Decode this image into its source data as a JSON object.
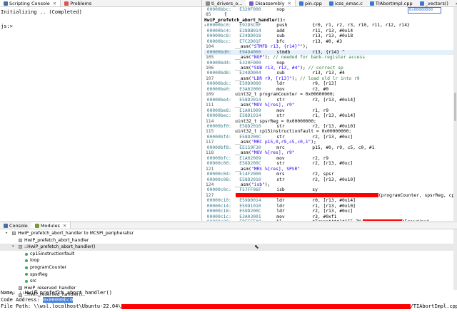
{
  "top_left": {
    "tabs": [
      {
        "label": "Scripting Console",
        "close": "✕"
      },
      {
        "label": "Problems"
      }
    ],
    "lines": [
      "Initializing .. (Completed)",
      "",
      "js:>"
    ]
  },
  "disasm": {
    "tabs": [
      {
        "label": "ti_drivers_o..."
      },
      {
        "label": "Disassembly",
        "close": "✕"
      },
      {
        "label": "pin.cpp"
      },
      {
        "label": "icss_emac.c"
      },
      {
        "label": "TIAbortImpl.cpp"
      },
      {
        "label": "_vectors()"
      },
      {
        "label": "»8"
      }
    ],
    "address_box": "0x00000000",
    "rows": [
      {
        "k": "asm",
        "a": "00000bbc:",
        "h": "E320F000",
        "m": "nop",
        "o": ""
      },
      {
        "k": "src",
        "ln": "85",
        "t": "{"
      },
      {
        "k": "lbl",
        "t": "HwiP_prefetch_abort_handler():"
      },
      {
        "k": "asm",
        "a": "00000bc0:",
        "h": "E92D5C0F",
        "m": "push",
        "o": "{r0, r1, r2, r3, r10, r11, r12, r14}",
        "cur": true
      },
      {
        "k": "asm",
        "a": "00000bc4:",
        "h": "E28DB014",
        "m": "add",
        "o": "r11, r13, #0x14"
      },
      {
        "k": "asm",
        "a": "00000bc8:",
        "h": "E24DD018",
        "m": "sub",
        "o": "r13, r13, #0x18"
      },
      {
        "k": "asm",
        "a": "00000bcc:",
        "h": "E7C2D01F",
        "m": "bfc",
        "o": "r13, #0, #3"
      },
      {
        "k": "src",
        "ln": "104",
        "t": "    __asm(",
        "s": "\"STMFD r13, {r14}^\"",
        "e": ");"
      },
      {
        "k": "asm",
        "a": "00000bd0:",
        "h": "E94D4000",
        "m": "stmdb",
        "o": "r13, {r14} ^",
        "hl": true
      },
      {
        "k": "src",
        "ln": "105",
        "t": "    __asm(",
        "s": "\"NOP\"",
        "e": "); ",
        "c": "// needed for bank-register access"
      },
      {
        "k": "asm",
        "a": "00000bd4:",
        "h": "E320F000",
        "m": "nop",
        "o": ""
      },
      {
        "k": "src",
        "ln": "106",
        "t": "    __asm(",
        "s": "\"SUB r13, r13, #4\"",
        "e": "); ",
        "c": "// correct sp"
      },
      {
        "k": "asm",
        "a": "00000bd8:",
        "h": "E24DD004",
        "m": "sub",
        "o": "r13, r13, #4"
      },
      {
        "k": "src",
        "ln": "107",
        "t": "    __asm(",
        "s": "\"LDR r9, [r13]\"",
        "e": "); ",
        "c": "// load old lr into r9"
      },
      {
        "k": "asm",
        "a": "00000bdc:",
        "h": "E59D9000",
        "m": "ldr",
        "o": "r9, [r13]"
      },
      {
        "k": "asm",
        "a": "00000be0:",
        "h": "E3A02000",
        "m": "mov",
        "o": "r2, #0"
      },
      {
        "k": "src",
        "ln": "109",
        "t": "    uint32_t programCounter = 0x00000000;"
      },
      {
        "k": "asm",
        "a": "00000be4:",
        "h": "E58D2014",
        "m": "str",
        "o": "r2, [r13, #0x14]"
      },
      {
        "k": "src",
        "ln": "111",
        "t": "    __asm(",
        "s": "\"MOV %[res], r9\"",
        "e": ""
      },
      {
        "k": "asm",
        "a": "00000be8:",
        "h": "E1A01009",
        "m": "mov",
        "o": "r1, r9"
      },
      {
        "k": "asm",
        "a": "00000bec:",
        "h": "E58D1014",
        "m": "str",
        "o": "r1, [r13, #0x14]"
      },
      {
        "k": "src",
        "ln": "114",
        "t": "    uint32_t spsrReg = 0x00000000;"
      },
      {
        "k": "asm",
        "a": "00000bf0:",
        "h": "E58D2010",
        "m": "str",
        "o": "r2, [r13, #0x10]"
      },
      {
        "k": "src",
        "ln": "115",
        "t": "    uint32_t cp15instructionfault = 0x00000000;"
      },
      {
        "k": "asm",
        "a": "00000bf4:",
        "h": "E58D200C",
        "m": "str",
        "o": "r2, [r13, #0xc]"
      },
      {
        "k": "src",
        "ln": "117",
        "t": "    __asm(",
        "s": "\"MRC p15,0,r9,c5,c0,1\"",
        "e": ");"
      },
      {
        "k": "asm",
        "a": "00000bf8:",
        "h": "EE159F30",
        "m": "mrc",
        "o": "p15, #0, r9, c5, c0, #1"
      },
      {
        "k": "src",
        "ln": "118",
        "t": "    __asm(",
        "s": "\"MOV %[res], r9\"",
        "e": ""
      },
      {
        "k": "asm",
        "a": "00000bfc:",
        "h": "E1A02009",
        "m": "mov",
        "o": "r2, r9"
      },
      {
        "k": "asm",
        "a": "00000c00:",
        "h": "E58D200C",
        "m": "str",
        "o": "r2, [r13, #0xc]"
      },
      {
        "k": "src",
        "ln": "121",
        "t": "    __asm(",
        "s": "\"MRS %[res], SPSR\"",
        "e": ""
      },
      {
        "k": "asm",
        "a": "00000c04:",
        "h": "E14F2000",
        "m": "mrs",
        "o": "r2, spsr"
      },
      {
        "k": "asm",
        "a": "00000c08:",
        "h": "E58D2010",
        "m": "str",
        "o": "r2, [r13, #0x10]"
      },
      {
        "k": "src",
        "ln": "124",
        "t": "    __asm(",
        "s": "\"isb\"",
        "e": ");"
      },
      {
        "k": "asm",
        "a": "00000c0c:",
        "h": "F57FF06F",
        "m": "isb",
        "o": "sy"
      },
      {
        "k": "red",
        "ln": "127",
        "t": "(programCounter, spsrReg, cp15in"
      },
      {
        "k": "asm",
        "a": "00000c10:",
        "h": "E59D0014",
        "m": "ldr",
        "o": "r0, [r13, #0x14]"
      },
      {
        "k": "asm",
        "a": "00000c14:",
        "h": "E59D1010",
        "m": "ldr",
        "o": "r1, [r13, #0x10]"
      },
      {
        "k": "asm",
        "a": "00000c18:",
        "h": "E59D200C",
        "m": "ldr",
        "o": "r2, [r13, #0xc]"
      },
      {
        "k": "asm",
        "a": "00000c1c:",
        "h": "E3A03001",
        "m": "mov",
        "o": "r3, #0xf1"
      },
      {
        "k": "asm",
        "a": "00000c20:",
        "h": "EBFFFFA8",
        "m": "bl",
        "o": "$Tramp$A$$1$155_7N",
        "tail": "2ErrorHand"
      }
    ]
  },
  "bottom": {
    "tabs": [
      {
        "label": "Console"
      },
      {
        "label": "Modules",
        "close": "✕"
      }
    ],
    "tree": [
      {
        "indent": 0,
        "arrow": "▸",
        "icon": "fn",
        "label": "HwiP_prefetch_abort_handler to MCSPI_peripheralIsr"
      },
      {
        "indent": 1,
        "arrow": "",
        "icon": "fn",
        "label": "HwiP_prefetch_abort_handler"
      },
      {
        "indent": 1,
        "arrow": "▾",
        "icon": "fn",
        "label": "::HwiP_prefetch_abort_handler()",
        "sel": true
      },
      {
        "indent": 2,
        "arrow": "",
        "icon": "dot",
        "label": "cp15instructionfault"
      },
      {
        "indent": 2,
        "arrow": "",
        "icon": "dot",
        "label": "loop"
      },
      {
        "indent": 2,
        "arrow": "",
        "icon": "dot",
        "label": "programCounter"
      },
      {
        "indent": 2,
        "arrow": "",
        "icon": "dot",
        "label": "spsrReg"
      },
      {
        "indent": 2,
        "arrow": "",
        "icon": "dot",
        "label": "src"
      },
      {
        "indent": 1,
        "arrow": "",
        "icon": "fn",
        "label": "HwiP_reserved_handler"
      },
      {
        "indent": 1,
        "arrow": "▸",
        "icon": "fn",
        "label": "::HwiP_reserved_handler()"
      }
    ],
    "info": {
      "name_label": "Name: ",
      "name_value": "::HwiP_prefetch_abort_handler()",
      "code_label": "Code Address: ",
      "code_value": "0x00000bc0",
      "file_label": "File Path: ",
      "file_prefix": "\\\\wsl.localhost\\Ubuntu-22.04\\",
      "file_suffix": "/TIAbortImpl.cpp"
    }
  },
  "colors": {
    "accent": "#3b78d6",
    "redaction": "#ff0000",
    "addr": "#3d7a8c",
    "comment": "#2e7d32",
    "string": "#2a00ff"
  }
}
